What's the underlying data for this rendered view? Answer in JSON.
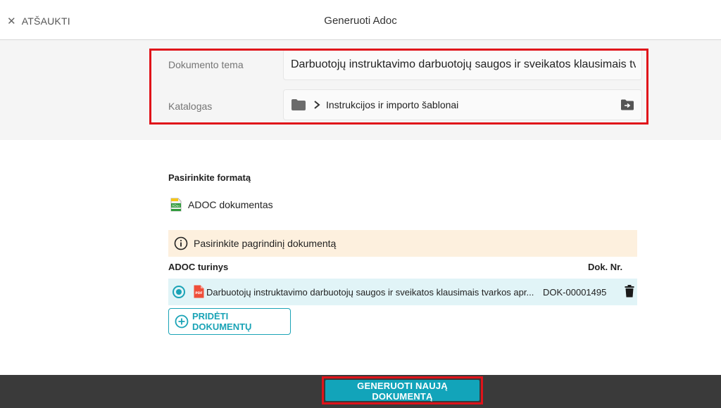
{
  "header": {
    "cancel_label": "ATŠAUKTI",
    "title": "Generuoti Adoc"
  },
  "form": {
    "subject_label": "Dokumento tema",
    "subject_value": "Darbuotojų instruktavimo darbuotojų saugos ir sveikatos klausimais tvarkos aprašas",
    "catalog_label": "Katalogas",
    "catalog_value": "Instrukcijos ir importo šablonai"
  },
  "format": {
    "section_label": "Pasirinkite formatą",
    "option_label": "ADOC dokumentas",
    "icon_text": "ADoc"
  },
  "notice": {
    "text": "Pasirinkite pagrindinį dokumentą"
  },
  "table": {
    "content_header": "ADOC turinys",
    "number_header": "Dok. Nr.",
    "rows": [
      {
        "title": "Darbuotojų instruktavimo darbuotojų saugos ir sveikatos klausimais tvarkos apr...",
        "number": "DOK-00001495",
        "file_badge": "PDF",
        "selected": true
      }
    ]
  },
  "add_button_label": "PRIDĖTI DOKUMENTŲ",
  "generate_button_label": "GENERUOTI NAUJĄ DOKUMENTĄ",
  "colors": {
    "accent": "#12a4ba",
    "highlight": "#e0131a",
    "notice_bg": "#fdf0de",
    "row_bg": "#e1f4f7",
    "footer_bg": "#3a3a3a"
  }
}
